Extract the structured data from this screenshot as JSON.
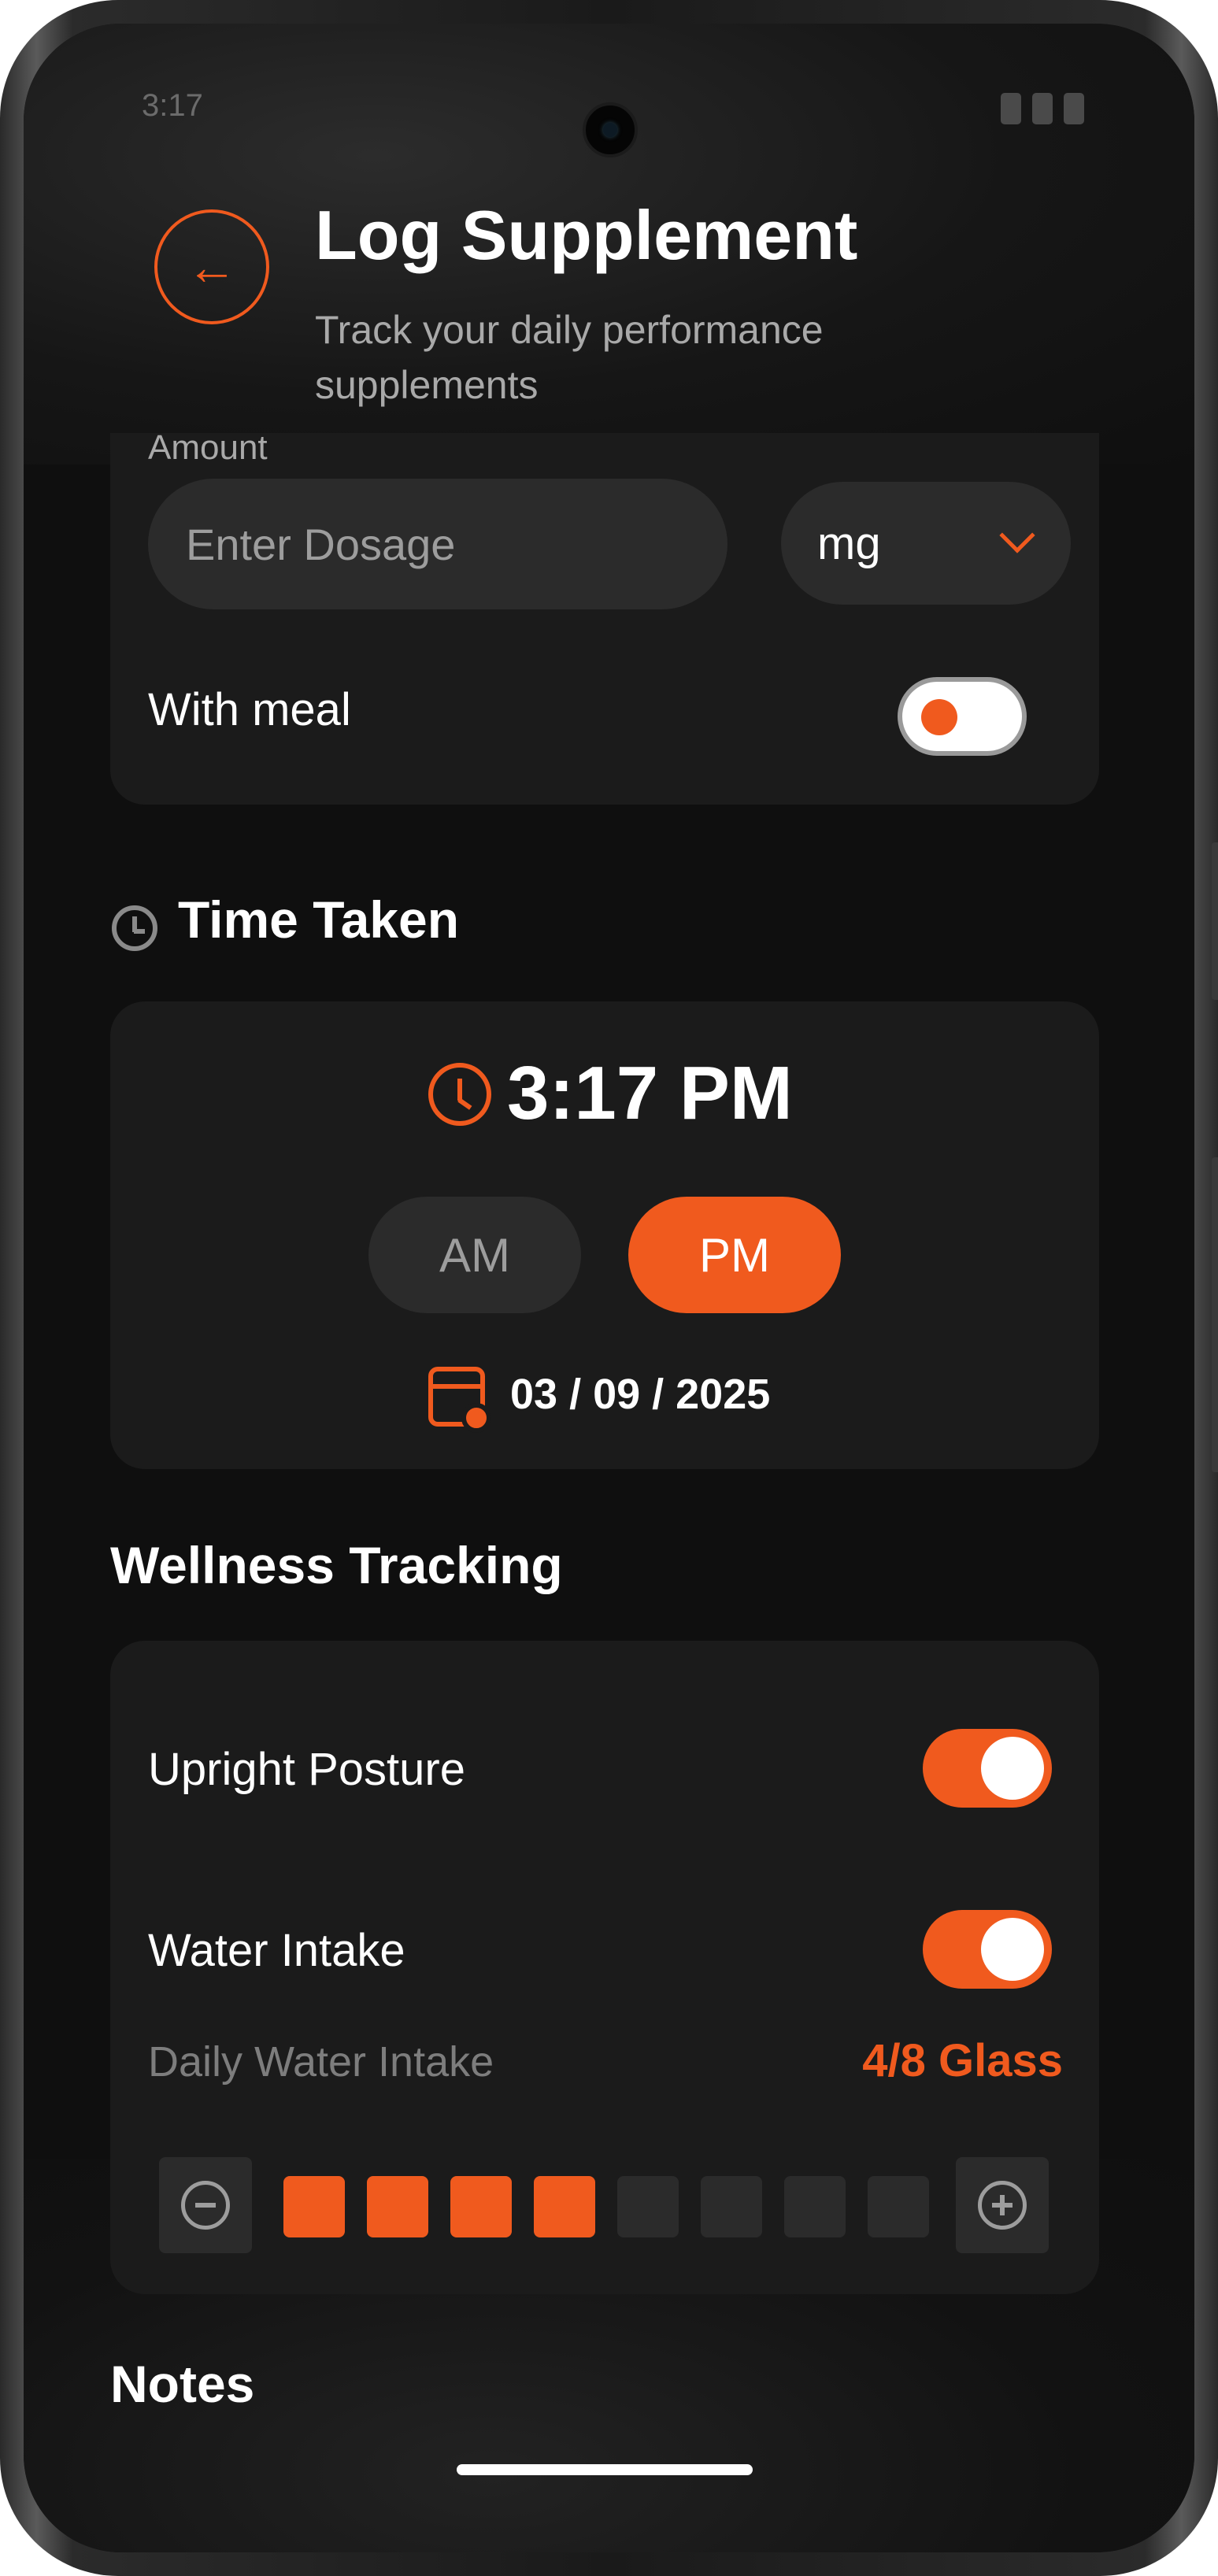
{
  "status_bar": {
    "time": "3:17"
  },
  "header": {
    "title": "Log Supplement",
    "subtitle": "Track your daily performance supplements"
  },
  "dosage": {
    "amount_label": "Amount",
    "input_placeholder": "Enter Dosage",
    "input_value": "",
    "unit_selected": "mg",
    "with_meal_label": "With meal",
    "with_meal_on": false
  },
  "time_taken": {
    "section_title": "Time Taken",
    "time": "3:17 PM",
    "am_label": "AM",
    "pm_label": "PM",
    "selected_period": "PM",
    "date": "03 / 09 / 2025"
  },
  "wellness": {
    "section_title": "Wellness Tracking",
    "upright_posture_label": "Upright Posture",
    "upright_posture_on": true,
    "water_intake_label": "Water Intake",
    "water_intake_on": true,
    "daily_water_label": "Daily Water Intake",
    "daily_water_count": "4/8 Glass",
    "glasses_filled": 4,
    "glasses_total": 8
  },
  "notes": {
    "section_title": "Notes"
  },
  "colors": {
    "accent": "#f05a1e",
    "background": "#0f0f0f",
    "card": "#1b1b1b",
    "control": "#2b2b2b"
  },
  "icons": [
    "back-arrow-icon",
    "chevron-down-icon",
    "clock-icon",
    "calendar-icon",
    "minus-icon",
    "plus-icon"
  ]
}
